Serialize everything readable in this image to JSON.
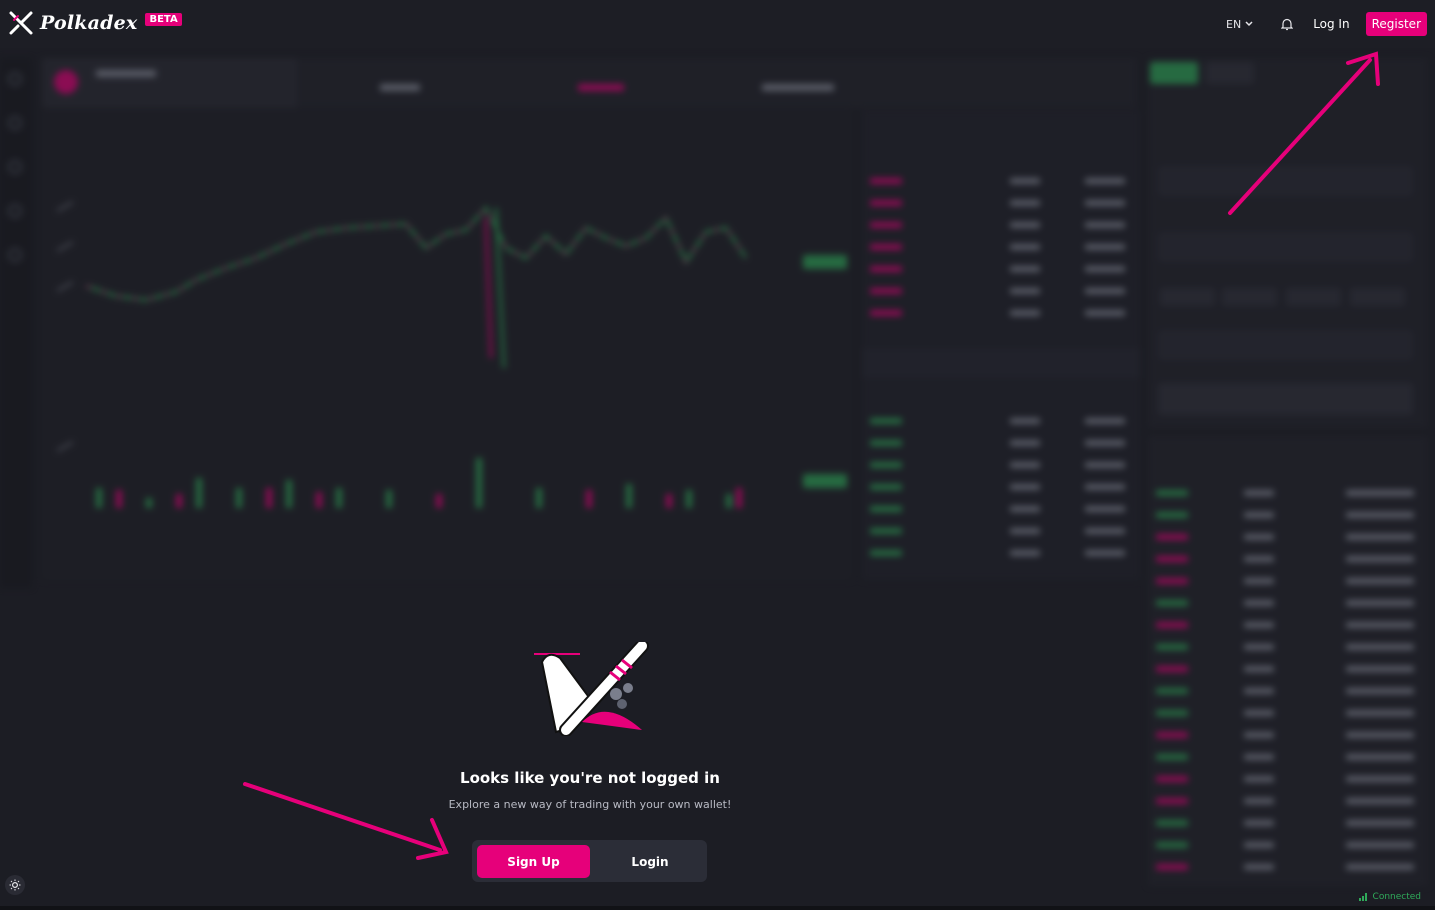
{
  "header": {
    "brand": "Polkadex",
    "beta_badge": "BETA",
    "language": "EN",
    "login_label": "Log In",
    "register_label": "Register"
  },
  "auth_prompt": {
    "title": "Looks like you're not logged in",
    "subtitle": "Explore a new way of trading with your own wallet!",
    "signup_label": "Sign Up",
    "login_label": "Login"
  },
  "footer": {
    "connection_status": "Connected"
  },
  "colors": {
    "accent": "#e6007a",
    "background": "#1c1d24",
    "positive": "#2faa5a",
    "annotation_arrow": "#e6007a"
  },
  "icons": [
    "polkadex-logo-icon",
    "chevron-down-icon",
    "bell-icon",
    "sun-icon",
    "signal-icon"
  ]
}
